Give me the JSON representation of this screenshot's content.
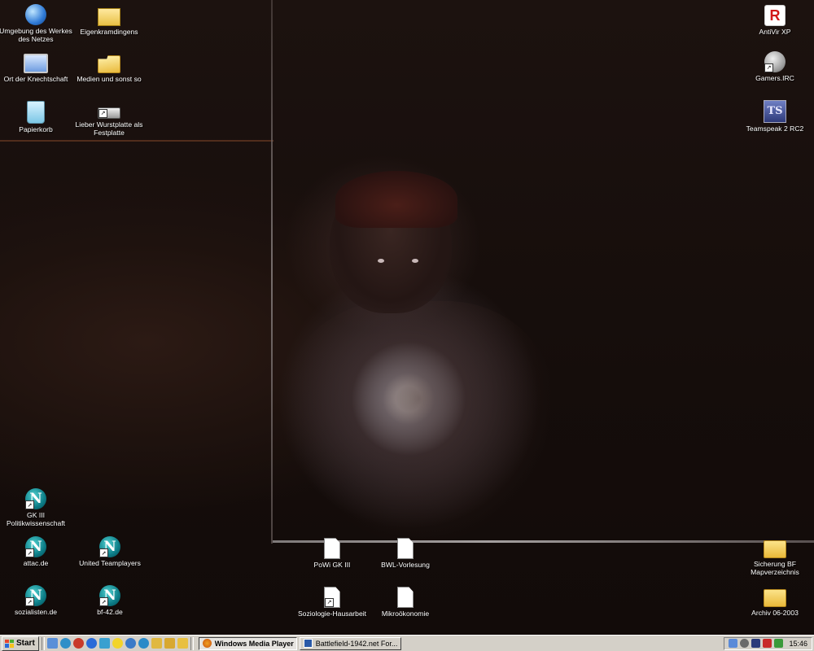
{
  "desktop": {
    "icons_left": [
      {
        "label": "Umgebung des Werkes des Netzes"
      },
      {
        "label": "Eigenkramdingens"
      },
      {
        "label": "Ort der Knechtschaft"
      },
      {
        "label": "Medien und sonst so"
      },
      {
        "label": "Papierkorb"
      },
      {
        "label": "Lieber Wurstplatte als Festplatte"
      }
    ],
    "icons_right": [
      {
        "label": "AntiVir XP"
      },
      {
        "label": "Gamers.IRC"
      },
      {
        "label": "Teamspeak 2 RC2"
      }
    ],
    "icons_bottom_left": [
      {
        "label": "GK III Politikwissenschaft"
      },
      {
        "label": "attac.de"
      },
      {
        "label": "United Teamplayers"
      },
      {
        "label": "sozialisten.de"
      },
      {
        "label": "bf-42.de"
      }
    ],
    "icons_bottom_center": [
      {
        "label": "PoWi GK III"
      },
      {
        "label": "BWL-Vorlesung"
      },
      {
        "label": "Soziologie-Hausarbeit"
      },
      {
        "label": "Mikroökonomie"
      }
    ],
    "icons_bottom_right": [
      {
        "label": "Sicherung BF Mapverzeichnis"
      },
      {
        "label": "Archiv 06-2003"
      }
    ],
    "glyph_text": {
      "antivir": "R",
      "teamspeak": "TS",
      "netscape": "N"
    }
  },
  "taskbar": {
    "start_label": "Start",
    "tasks": [
      {
        "label": "Windows Media Player",
        "active": true
      },
      {
        "label": "Battlefield-1942.net For...",
        "active": false
      }
    ],
    "clock": "15:46"
  },
  "colors": {
    "taskbar_bg": "#d4d0c8",
    "desktop_bg": "#140c0a",
    "icon_label": "#ffffff"
  }
}
